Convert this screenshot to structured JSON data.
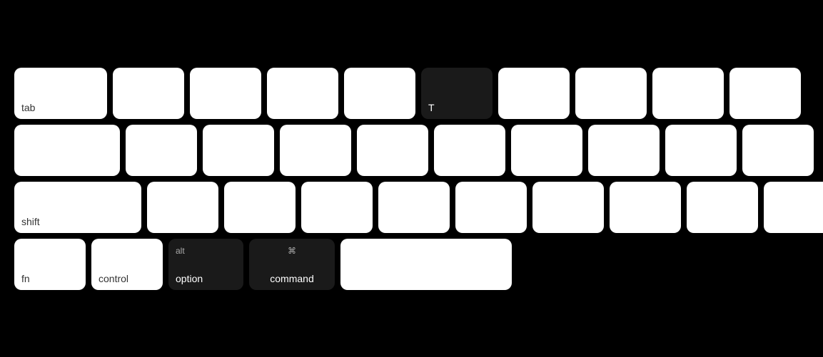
{
  "keyboard": {
    "rows": [
      {
        "id": "row1",
        "keys": [
          {
            "id": "tab",
            "label": "tab",
            "top": "",
            "dark": false,
            "width": "tab"
          },
          {
            "id": "q",
            "label": "",
            "top": "",
            "dark": false,
            "width": "1"
          },
          {
            "id": "w",
            "label": "",
            "top": "",
            "dark": false,
            "width": "1"
          },
          {
            "id": "e",
            "label": "",
            "top": "",
            "dark": false,
            "width": "1"
          },
          {
            "id": "r",
            "label": "",
            "top": "",
            "dark": false,
            "width": "1"
          },
          {
            "id": "t",
            "label": "T",
            "top": "",
            "dark": true,
            "width": "1"
          },
          {
            "id": "y",
            "label": "",
            "top": "",
            "dark": false,
            "width": "1"
          },
          {
            "id": "u",
            "label": "",
            "top": "",
            "dark": false,
            "width": "1"
          },
          {
            "id": "i",
            "label": "",
            "top": "",
            "dark": false,
            "width": "1"
          },
          {
            "id": "o",
            "label": "",
            "top": "",
            "dark": false,
            "width": "1"
          }
        ]
      },
      {
        "id": "row2",
        "keys": [
          {
            "id": "caps",
            "label": "",
            "top": "",
            "dark": false,
            "width": "caps"
          },
          {
            "id": "a",
            "label": "",
            "top": "",
            "dark": false,
            "width": "1"
          },
          {
            "id": "s",
            "label": "",
            "top": "",
            "dark": false,
            "width": "1"
          },
          {
            "id": "d",
            "label": "",
            "top": "",
            "dark": false,
            "width": "1"
          },
          {
            "id": "f",
            "label": "",
            "top": "",
            "dark": false,
            "width": "1"
          },
          {
            "id": "g",
            "label": "",
            "top": "",
            "dark": false,
            "width": "1"
          },
          {
            "id": "h",
            "label": "",
            "top": "",
            "dark": false,
            "width": "1"
          },
          {
            "id": "j",
            "label": "",
            "top": "",
            "dark": false,
            "width": "1"
          },
          {
            "id": "k",
            "label": "",
            "top": "",
            "dark": false,
            "width": "1"
          },
          {
            "id": "l",
            "label": "",
            "top": "",
            "dark": false,
            "width": "1"
          }
        ]
      },
      {
        "id": "row3",
        "keys": [
          {
            "id": "shift-l",
            "label": "shift",
            "top": "",
            "dark": false,
            "width": "shift-l"
          },
          {
            "id": "z",
            "label": "",
            "top": "",
            "dark": false,
            "width": "1"
          },
          {
            "id": "x",
            "label": "",
            "top": "",
            "dark": false,
            "width": "1"
          },
          {
            "id": "c",
            "label": "",
            "top": "",
            "dark": false,
            "width": "1"
          },
          {
            "id": "v",
            "label": "",
            "top": "",
            "dark": false,
            "width": "1"
          },
          {
            "id": "b",
            "label": "",
            "top": "",
            "dark": false,
            "width": "1"
          },
          {
            "id": "n",
            "label": "",
            "top": "",
            "dark": false,
            "width": "1"
          },
          {
            "id": "m",
            "label": "",
            "top": "",
            "dark": false,
            "width": "1"
          },
          {
            "id": "comma",
            "label": "",
            "top": "",
            "dark": false,
            "width": "1"
          },
          {
            "id": "period",
            "label": "",
            "top": "",
            "dark": false,
            "width": "1"
          }
        ]
      },
      {
        "id": "row4",
        "keys": [
          {
            "id": "fn",
            "label": "fn",
            "top": "",
            "dark": false,
            "width": "fn"
          },
          {
            "id": "control",
            "label": "control",
            "top": "",
            "dark": false,
            "width": "ctrl"
          },
          {
            "id": "alt",
            "label": "option",
            "top": "alt",
            "dark": true,
            "width": "alt"
          },
          {
            "id": "command",
            "label": "command",
            "top": "⌘",
            "dark": true,
            "width": "cmd"
          },
          {
            "id": "space",
            "label": "",
            "top": "",
            "dark": false,
            "width": "space"
          }
        ]
      }
    ]
  }
}
